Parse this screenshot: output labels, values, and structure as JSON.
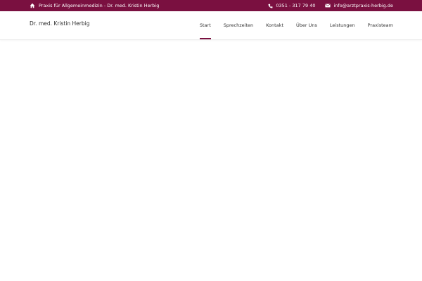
{
  "topbar": {
    "practice_name": "Praxis für Allgemeinmedizin - Dr. med. Kristin Herbig",
    "phone": "0351 - 317 79 40",
    "email": "info@arztpraxis-herbig.de",
    "home_icon": "home-icon",
    "phone_icon": "phone-icon",
    "email_icon": "envelope-icon"
  },
  "header": {
    "logo_text": "Dr. med. Kristin Herbig"
  },
  "nav": {
    "items": [
      {
        "label": "Start",
        "active": true
      },
      {
        "label": "Sprechzeiten",
        "active": false
      },
      {
        "label": "Kontakt",
        "active": false
      },
      {
        "label": "Über Uns",
        "active": false
      },
      {
        "label": "Leistungen",
        "active": false
      },
      {
        "label": "Praxisteam",
        "active": false
      }
    ]
  },
  "colors": {
    "brand": "#7a1040",
    "text": "#333333",
    "background": "#ffffff"
  }
}
